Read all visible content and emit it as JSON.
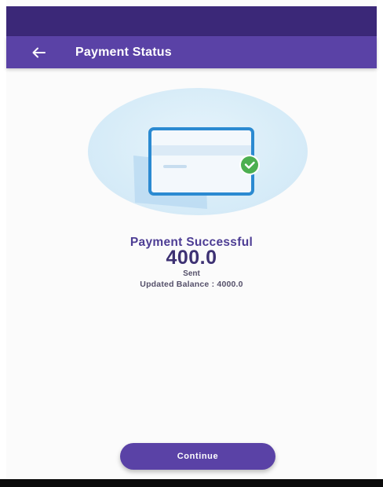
{
  "app_bar": {
    "title": "Payment Status",
    "back_icon": "arrow-left-icon"
  },
  "illustration": {
    "icon": "credit-card-check-icon"
  },
  "result": {
    "title": "Payment Successful",
    "amount": "400.0",
    "sent_label": "Sent",
    "balance_text": "Updated Balance : 4000.0"
  },
  "actions": {
    "continue_label": "Continue"
  },
  "colors": {
    "primary": "#5a42a6",
    "status_bar": "#3b2878",
    "success": "#4caf50",
    "card_outline": "#2b8ad1"
  }
}
